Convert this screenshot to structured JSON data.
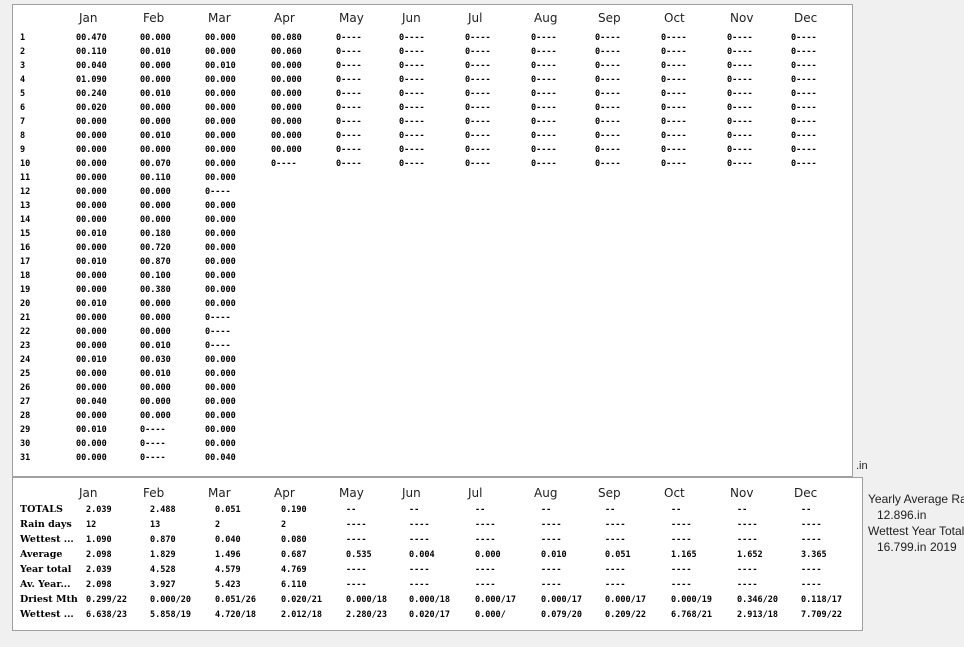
{
  "months": [
    "Jan",
    "Feb",
    "Mar",
    "Apr",
    "May",
    "Jun",
    "Jul",
    "Aug",
    "Sep",
    "Oct",
    "Nov",
    "Dec"
  ],
  "days": [
    "1",
    "2",
    "3",
    "4",
    "5",
    "6",
    "7",
    "8",
    "9",
    "10",
    "11",
    "12",
    "13",
    "14",
    "15",
    "16",
    "17",
    "18",
    "19",
    "20",
    "21",
    "22",
    "23",
    "24",
    "25",
    "26",
    "27",
    "28",
    "29",
    "30",
    "31"
  ],
  "daily": [
    [
      "00.470",
      "00.110",
      "00.040",
      "01.090",
      "00.240",
      "00.020",
      "00.000",
      "00.000",
      "00.000",
      "00.000",
      "00.000",
      "00.000",
      "00.000",
      "00.000",
      "00.010",
      "00.000",
      "00.010",
      "00.000",
      "00.000",
      "00.010",
      "00.000",
      "00.000",
      "00.000",
      "00.010",
      "00.000",
      "00.000",
      "00.040",
      "00.000",
      "00.010",
      "00.000",
      "00.000"
    ],
    [
      "00.000",
      "00.010",
      "00.000",
      "00.000",
      "00.010",
      "00.000",
      "00.000",
      "00.010",
      "00.000",
      "00.070",
      "00.110",
      "00.000",
      "00.000",
      "00.000",
      "00.180",
      "00.720",
      "00.870",
      "00.100",
      "00.380",
      "00.000",
      "00.000",
      "00.000",
      "00.010",
      "00.030",
      "00.010",
      "00.000",
      "00.000",
      "00.000",
      "0----",
      "0----",
      "0----"
    ],
    [
      "00.000",
      "00.000",
      "00.010",
      "00.000",
      "00.000",
      "00.000",
      "00.000",
      "00.000",
      "00.000",
      "00.000",
      "00.000",
      "0----",
      "00.000",
      "00.000",
      "00.000",
      "00.000",
      "00.000",
      "00.000",
      "00.000",
      "00.000",
      "0----",
      "0----",
      "0----",
      "00.000",
      "00.000",
      "00.000",
      "00.000",
      "00.000",
      "00.000",
      "00.000",
      "00.040"
    ],
    [
      "00.080",
      "00.060",
      "00.000",
      "00.000",
      "00.000",
      "00.000",
      "00.000",
      "00.000",
      "00.000",
      "0----"
    ],
    [
      "0----",
      "0----",
      "0----",
      "0----",
      "0----",
      "0----",
      "0----",
      "0----",
      "0----",
      "0----"
    ],
    [
      "0----",
      "0----",
      "0----",
      "0----",
      "0----",
      "0----",
      "0----",
      "0----",
      "0----",
      "0----"
    ],
    [
      "0----",
      "0----",
      "0----",
      "0----",
      "0----",
      "0----",
      "0----",
      "0----",
      "0----",
      "0----"
    ],
    [
      "0----",
      "0----",
      "0----",
      "0----",
      "0----",
      "0----",
      "0----",
      "0----",
      "0----",
      "0----"
    ],
    [
      "0----",
      "0----",
      "0----",
      "0----",
      "0----",
      "0----",
      "0----",
      "0----",
      "0----",
      "0----"
    ],
    [
      "0----",
      "0----",
      "0----",
      "0----",
      "0----",
      "0----",
      "0----",
      "0----",
      "0----",
      "0----"
    ],
    [
      "0----",
      "0----",
      "0----",
      "0----",
      "0----",
      "0----",
      "0----",
      "0----",
      "0----",
      "0----"
    ],
    [
      "0----",
      "0----",
      "0----",
      "0----",
      "0----",
      "0----",
      "0----",
      "0----",
      "0----",
      "0----"
    ]
  ],
  "unit": ".in",
  "summary_rows": [
    {
      "label": "TOTALS",
      "values": [
        "2.039",
        "2.488",
        "0.051",
        "0.190",
        "--",
        "--",
        "--",
        "--",
        "--",
        "--",
        "--",
        "--"
      ]
    },
    {
      "label": "Rain days",
      "values": [
        "12",
        "13",
        "2",
        "2",
        "----",
        "----",
        "----",
        "----",
        "----",
        "----",
        "----",
        "----"
      ]
    },
    {
      "label": "Wettest ...",
      "values": [
        "1.090",
        "0.870",
        "0.040",
        "0.080",
        "----",
        "----",
        "----",
        "----",
        "----",
        "----",
        "----",
        "----"
      ]
    },
    {
      "label": "Average",
      "values": [
        "2.098",
        "1.829",
        "1.496",
        "0.687",
        "0.535",
        "0.004",
        "0.000",
        "0.010",
        "0.051",
        "1.165",
        "1.652",
        "3.365"
      ]
    },
    {
      "label": "Year total",
      "values": [
        "2.039",
        "4.528",
        "4.579",
        "4.769",
        "----",
        "----",
        "----",
        "----",
        "----",
        "----",
        "----",
        "----"
      ]
    },
    {
      "label": "Av. Year...",
      "values": [
        "2.098",
        "3.927",
        "5.423",
        "6.110",
        "----",
        "----",
        "----",
        "----",
        "----",
        "----",
        "----",
        "----"
      ]
    },
    {
      "label": "Driest Mth",
      "values": [
        "0.299/22",
        "0.000/20",
        "0.051/26",
        "0.020/21",
        "0.000/18",
        "0.000/18",
        "0.000/17",
        "0.000/17",
        "0.000/17",
        "0.000/19",
        "0.346/20",
        "0.118/17"
      ]
    },
    {
      "label": "Wettest ...",
      "values": [
        "6.638/23",
        "5.858/19",
        "4.720/18",
        "2.012/18",
        "2.280/23",
        "0.020/17",
        "0.000/",
        "0.079/20",
        "0.209/22",
        "6.768/21",
        "2.913/18",
        "7.709/22"
      ]
    }
  ],
  "side_info": {
    "yearly_avg_label": "Yearly Average Rain",
    "yearly_avg_value": "12.896.in",
    "wettest_year_label": "Wettest Year Total",
    "wettest_year_value": "16.799.in",
    "wettest_year": "2019"
  }
}
